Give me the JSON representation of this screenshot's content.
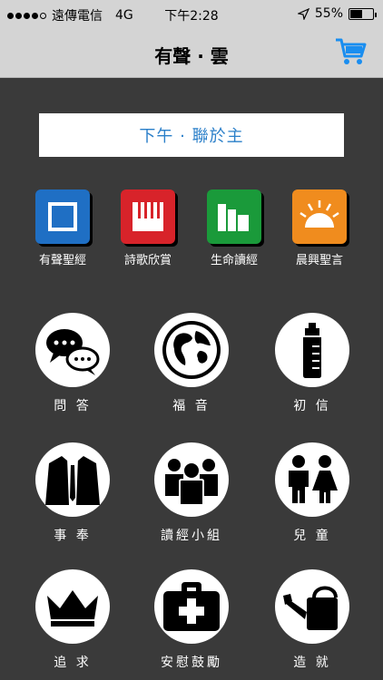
{
  "status_bar": {
    "carrier": "遠傳電信",
    "network": "4G",
    "time": "下午2:28",
    "battery": "55%",
    "battery_level": 0.55
  },
  "nav": {
    "title": "有聲 · 雲",
    "cart_icon": "cart-icon"
  },
  "banner": {
    "text": "下午 · 聯於主"
  },
  "apps": [
    {
      "label": "有聲聖經",
      "icon": "book-icon",
      "color": "#1f6fc4"
    },
    {
      "label": "詩歌欣賞",
      "icon": "piano-icon",
      "color": "#d8232a"
    },
    {
      "label": "生命讀經",
      "icon": "books-icon",
      "color": "#1a9a3a"
    },
    {
      "label": "晨興聖言",
      "icon": "sunrise-icon",
      "color": "#f08c1e"
    }
  ],
  "grid": [
    {
      "label": "問 答",
      "icon": "chat-bubbles-icon"
    },
    {
      "label": "福 音",
      "icon": "globe-icon"
    },
    {
      "label": "初 信",
      "icon": "baby-bottle-icon"
    },
    {
      "label": "事 奉",
      "icon": "suit-icon"
    },
    {
      "label": "讀經小組",
      "icon": "group-icon"
    },
    {
      "label": "兒 童",
      "icon": "children-icon"
    },
    {
      "label": "追 求",
      "icon": "crown-icon"
    },
    {
      "label": "安慰鼓勵",
      "icon": "first-aid-kit-icon"
    },
    {
      "label": "造 就",
      "icon": "watering-can-icon"
    }
  ]
}
